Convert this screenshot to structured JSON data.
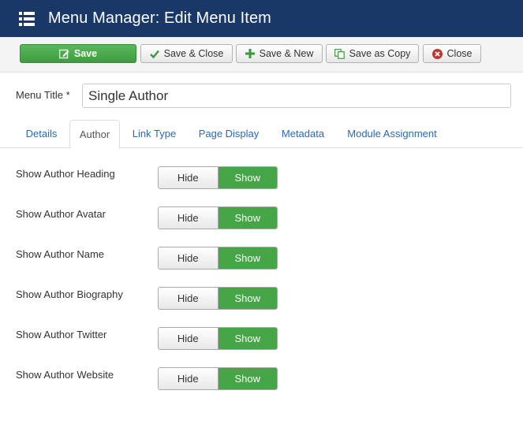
{
  "header": {
    "title": "Menu Manager: Edit Menu Item",
    "icon": "list-icon"
  },
  "toolbar": {
    "save": "Save",
    "save_close": "Save & Close",
    "save_new": "Save & New",
    "save_copy": "Save as Copy",
    "close": "Close"
  },
  "form": {
    "menu_title_label": "Menu Title *",
    "menu_title_value": "Single Author"
  },
  "tabs": [
    "Details",
    "Author",
    "Link Type",
    "Page Display",
    "Metadata",
    "Module Assignment"
  ],
  "active_tab": "Author",
  "options": [
    {
      "label": "Show Author Heading",
      "hide": "Hide",
      "show": "Show",
      "selected": "Show"
    },
    {
      "label": "Show Author Avatar",
      "hide": "Hide",
      "show": "Show",
      "selected": "Show"
    },
    {
      "label": "Show Author Name",
      "hide": "Hide",
      "show": "Show",
      "selected": "Show"
    },
    {
      "label": "Show Author Biography",
      "hide": "Hide",
      "show": "Show",
      "selected": "Show"
    },
    {
      "label": "Show Author Twitter",
      "hide": "Hide",
      "show": "Show",
      "selected": "Show"
    },
    {
      "label": "Show Author Website",
      "hide": "Hide",
      "show": "Show",
      "selected": "Show"
    }
  ],
  "colors": {
    "header_bg": "#1a3867",
    "save_green": "#46a546",
    "link_blue": "#2a69b8"
  }
}
